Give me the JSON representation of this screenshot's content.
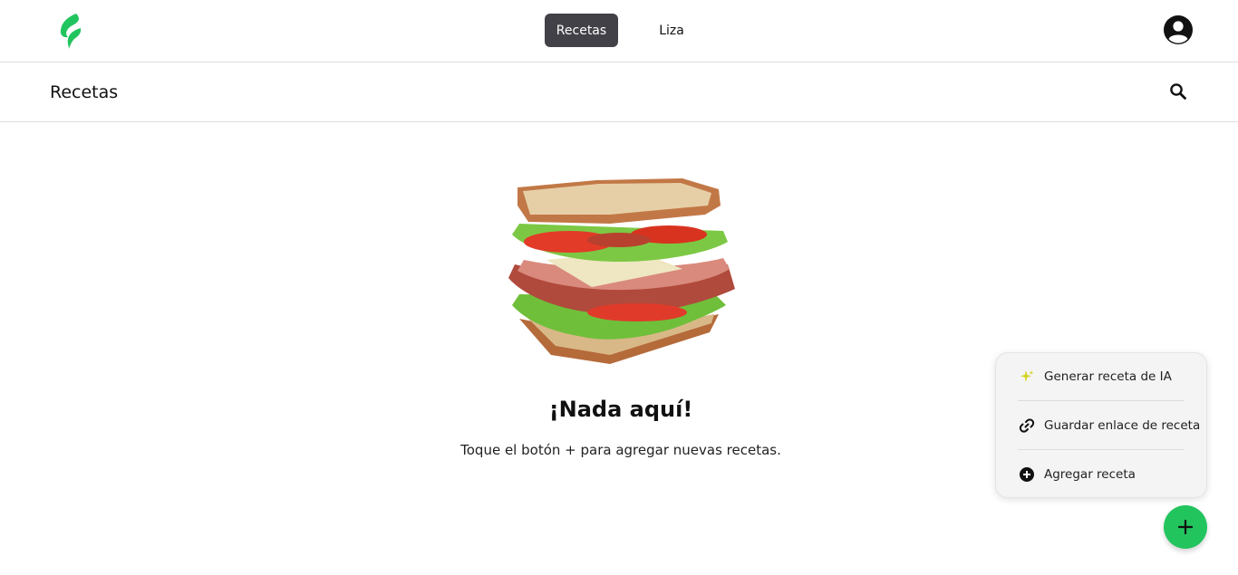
{
  "topbar": {
    "logo_icon": "leaf-logo-icon",
    "tabs": [
      {
        "label": "Recetas",
        "active": true
      },
      {
        "label": "Liza",
        "active": false
      }
    ],
    "avatar_icon": "account-circle-icon"
  },
  "header": {
    "title": "Recetas",
    "search_icon": "search-icon"
  },
  "empty_state": {
    "image": "sandwich-illustration",
    "title": "¡Nada aquí!",
    "message": "Toque el botón + para agregar nuevas recetas."
  },
  "add_menu": {
    "items": [
      {
        "label": "Generar receta de IA",
        "icon": "sparkles-icon"
      },
      {
        "label": "Guardar enlace de receta",
        "icon": "link-icon"
      },
      {
        "label": "Agregar receta",
        "icon": "plus-circle-icon"
      }
    ]
  },
  "fab": {
    "icon": "plus-icon"
  },
  "colors": {
    "brand_green": "#22c45e",
    "active_tab": "#414147",
    "sparkle": "#d4d31e"
  }
}
